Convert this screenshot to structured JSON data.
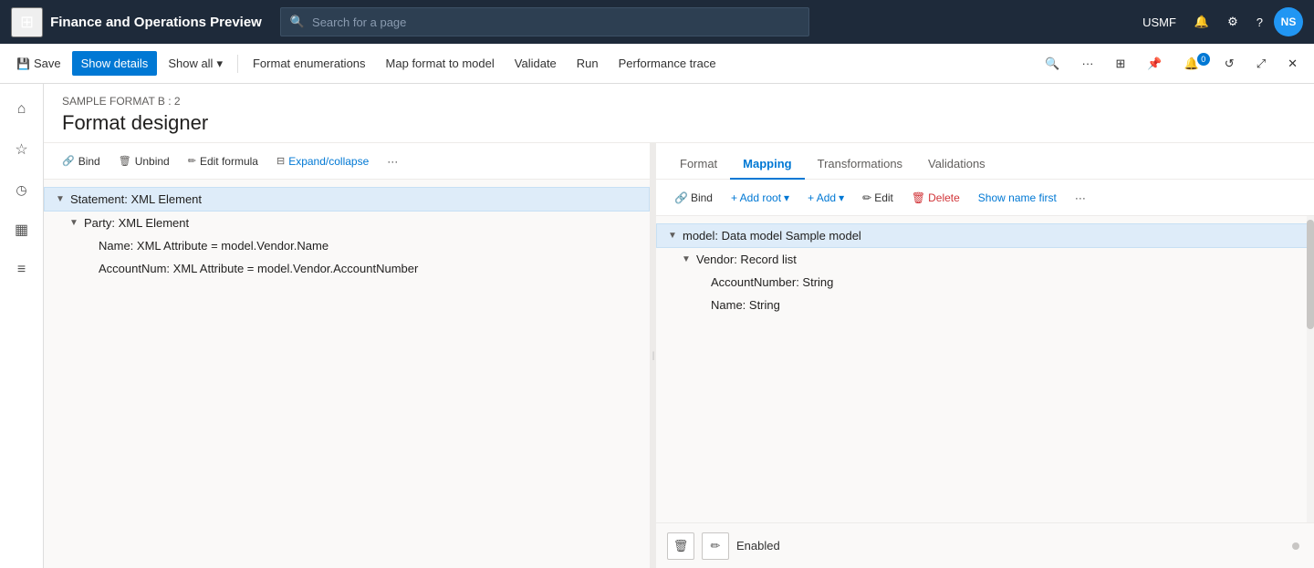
{
  "app": {
    "title": "Finance and Operations Preview",
    "search_placeholder": "Search for a page",
    "user_code": "USMF",
    "user_initials": "NS"
  },
  "toolbar": {
    "save_label": "Save",
    "show_details_label": "Show details",
    "show_all_label": "Show all",
    "format_enumerations_label": "Format enumerations",
    "map_format_label": "Map format to model",
    "validate_label": "Validate",
    "run_label": "Run",
    "performance_trace_label": "Performance trace"
  },
  "page": {
    "breadcrumb": "SAMPLE FORMAT B : 2",
    "title": "Format designer"
  },
  "left_panel": {
    "bind_label": "Bind",
    "unbind_label": "Unbind",
    "edit_formula_label": "Edit formula",
    "expand_collapse_label": "Expand/collapse",
    "more_label": "···",
    "tree_items": [
      {
        "id": 1,
        "indent": 0,
        "chevron": "▼",
        "label": "Statement: XML Element",
        "selected": true
      },
      {
        "id": 2,
        "indent": 1,
        "chevron": "▼",
        "label": "Party: XML Element",
        "selected": false
      },
      {
        "id": 3,
        "indent": 2,
        "chevron": "",
        "label": "Name: XML Attribute = model.Vendor.Name",
        "selected": false
      },
      {
        "id": 4,
        "indent": 2,
        "chevron": "",
        "label": "AccountNum: XML Attribute = model.Vendor.AccountNumber",
        "selected": false
      }
    ]
  },
  "right_panel": {
    "tabs": [
      {
        "id": "format",
        "label": "Format",
        "active": false
      },
      {
        "id": "mapping",
        "label": "Mapping",
        "active": true
      },
      {
        "id": "transformations",
        "label": "Transformations",
        "active": false
      },
      {
        "id": "validations",
        "label": "Validations",
        "active": false
      }
    ],
    "toolbar": {
      "bind_label": "Bind",
      "add_root_label": "+ Add root",
      "add_label": "+ Add",
      "edit_label": "Edit",
      "delete_label": "Delete",
      "show_name_first_label": "Show name first",
      "more_label": "···"
    },
    "tree_items": [
      {
        "id": 1,
        "indent": 0,
        "chevron": "▼",
        "label": "model: Data model Sample model",
        "selected": true
      },
      {
        "id": 2,
        "indent": 1,
        "chevron": "▼",
        "label": "Vendor: Record list",
        "selected": false
      },
      {
        "id": 3,
        "indent": 2,
        "chevron": "",
        "label": "AccountNumber: String",
        "selected": false
      },
      {
        "id": 4,
        "indent": 2,
        "chevron": "",
        "label": "Name: String",
        "selected": false
      }
    ],
    "bottom": {
      "delete_icon": "🗑",
      "edit_icon": "✏",
      "status_label": "Enabled"
    }
  },
  "icons": {
    "grid": "⊞",
    "home": "⌂",
    "star": "☆",
    "clock": "○",
    "table": "▦",
    "list": "≡",
    "filter": "⚡",
    "save": "💾",
    "search": "🔍",
    "bell": "🔔",
    "gear": "⚙",
    "question": "?",
    "link": "🔗",
    "trash": "🗑",
    "pencil": "✏",
    "expand": "⊟",
    "refresh": "↺",
    "open": "⤢",
    "close": "✕",
    "chevron_down": "▾",
    "more": "···"
  }
}
